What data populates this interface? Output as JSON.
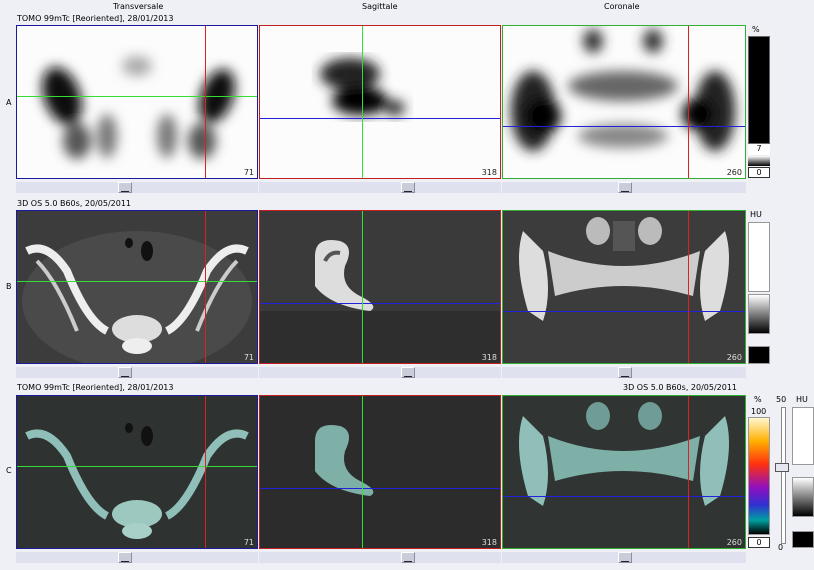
{
  "columns": {
    "transversale": "Transversale",
    "sagittale": "Sagittale",
    "coronale": "Coronale"
  },
  "rows": {
    "a": "A",
    "b": "B",
    "c": "C"
  },
  "headers": {
    "row_a": "TOMO 99mTc [Reoriented], 28/01/2013",
    "row_b": "3D  OS  5.0  B60s, 20/05/2011",
    "row_c_left": "TOMO 99mTc [Reoriented], 28/01/2013",
    "row_c_right": "3D  OS  5.0  B60s, 20/05/2011"
  },
  "slices": {
    "transversale": "71",
    "sagittale": "318",
    "coronale": "260"
  },
  "colorbars": {
    "row_a_unit": "%",
    "row_a_value": "7",
    "row_a_min": "0",
    "row_b_unit": "HU",
    "row_c_unit_pct": "%",
    "row_c_max": "100",
    "row_c_value": "50",
    "row_c_min": "0",
    "row_c_unit_hu": "HU",
    "row_c_zero": "0"
  },
  "colors": {
    "transversale_border": "#1a1a9a",
    "sagittale_border": "#c02020",
    "coronale_border": "#30b030",
    "crosshair_green": "#33dd33",
    "crosshair_red": "#dd2020",
    "crosshair_blue": "#2020dd"
  }
}
